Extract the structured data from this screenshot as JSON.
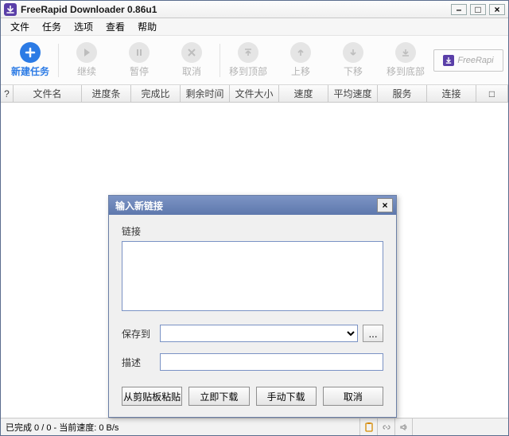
{
  "window": {
    "title": "FreeRapid Downloader 0.86u1"
  },
  "menu": {
    "file": "文件",
    "tasks": "任务",
    "options": "选项",
    "view": "查看",
    "help": "帮助"
  },
  "toolbar": {
    "new": "新建任务",
    "resume": "继续",
    "pause": "暂停",
    "cancel": "取消",
    "top": "移到顶部",
    "up": "上移",
    "down": "下移",
    "bottom": "移到底部"
  },
  "brand": {
    "text": "FreeRapi"
  },
  "columns": {
    "q": "?",
    "name": "文件名",
    "progress": "进度条",
    "percent": "完成比",
    "eta": "剩余时间",
    "size": "文件大小",
    "speed": "速度",
    "avg": "平均速度",
    "service": "服务",
    "conn": "连接",
    "last": "□"
  },
  "status": {
    "text": "已完成 0 / 0 - 当前速度: 0 B/s"
  },
  "modal": {
    "title": "输入新链接",
    "links_label": "链接",
    "links_value": "",
    "save_to_label": "保存到",
    "save_to_value": "",
    "browse_label": "...",
    "desc_label": "描述",
    "desc_value": "",
    "paste": "从剪贴板粘贴",
    "download_now": "立即下载",
    "download_manual": "手动下载",
    "cancel": "取消"
  }
}
